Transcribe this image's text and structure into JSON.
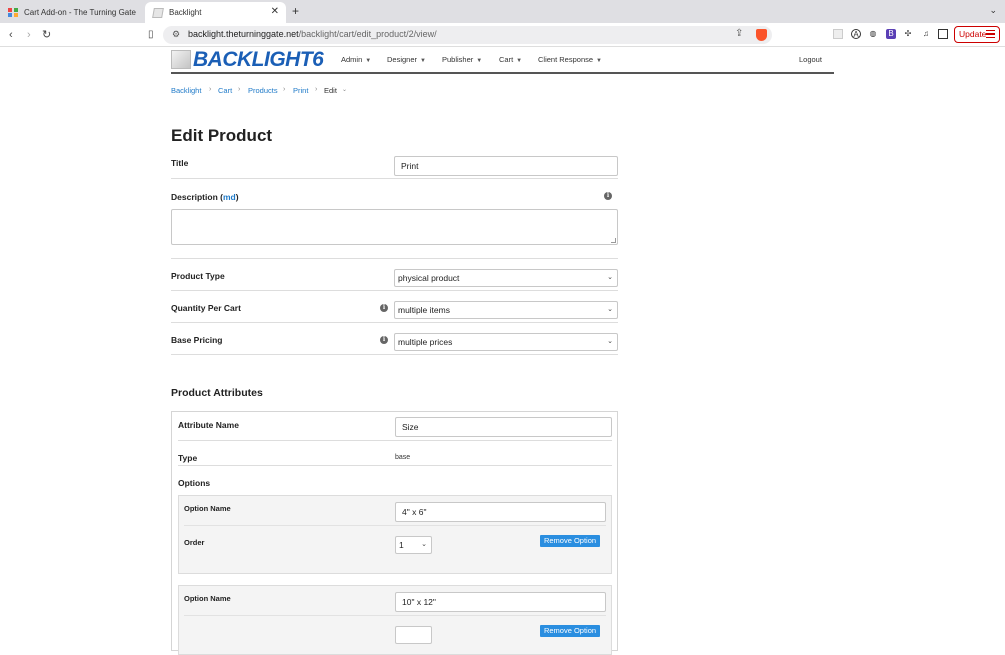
{
  "browser": {
    "tabs": [
      {
        "title": "Cart Add-on - The Turning Gate",
        "active": false
      },
      {
        "title": "Backlight",
        "active": true
      }
    ],
    "url_domain": "backlight.theturninggate.net",
    "url_path": "/backlight/cart/edit_product/2/view/",
    "update_label": "Update"
  },
  "header": {
    "logo_text": "BACKLIGHT6",
    "menu": [
      "Admin",
      "Designer",
      "Publisher",
      "Cart",
      "Client Response"
    ],
    "logout": "Logout"
  },
  "breadcrumb": [
    "Backlight",
    "Cart",
    "Products",
    "Print",
    "Edit"
  ],
  "page_title": "Edit Product",
  "form": {
    "title_label": "Title",
    "title_value": "Print",
    "description_label": "Description (",
    "description_md": "md",
    "description_close": ")",
    "product_type_label": "Product Type",
    "product_type_value": "physical product",
    "quantity_label": "Quantity Per Cart",
    "quantity_value": "multiple items",
    "pricing_label": "Base Pricing",
    "pricing_value": "multiple prices"
  },
  "attributes": {
    "section_title": "Product Attributes",
    "attribute_name_label": "Attribute Name",
    "attribute_name_value": "Size",
    "type_label": "Type",
    "type_value": "base",
    "options_label": "Options",
    "option_name_label": "Option Name",
    "order_label": "Order",
    "remove_label": "Remove Option",
    "options": [
      {
        "name": "4\" x 6\"",
        "order": "1"
      },
      {
        "name": "10\" x 12\"",
        "order": ""
      }
    ]
  },
  "colors": {
    "link": "#1f7ac8",
    "logo": "#1b5fb6",
    "button": "#2a8ee0",
    "brave_shield": "#fb542b"
  }
}
